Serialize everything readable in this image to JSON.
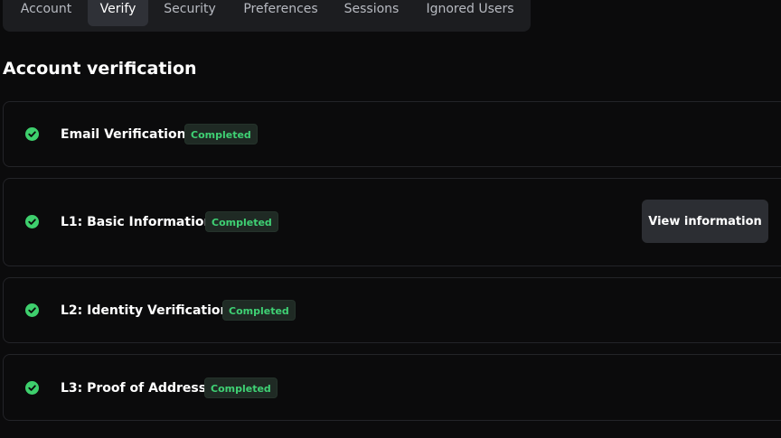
{
  "tabs": [
    {
      "label": "Account",
      "active": false
    },
    {
      "label": "Verify",
      "active": true
    },
    {
      "label": "Security",
      "active": false
    },
    {
      "label": "Preferences",
      "active": false
    },
    {
      "label": "Sessions",
      "active": false
    },
    {
      "label": "Ignored Users",
      "active": false
    }
  ],
  "page_title": "Account verification",
  "steps": [
    {
      "title": "Email Verification",
      "status": "Completed"
    },
    {
      "title": "L1: Basic Information",
      "status": "Completed",
      "action_label": "View information"
    },
    {
      "title": "L2: Identity Verification",
      "status": "Completed"
    },
    {
      "title": "L3: Proof of Address",
      "status": "Completed"
    }
  ],
  "colors": {
    "background": "#0b0b0c",
    "success_green": "#3ecf6d",
    "badge_bg": "#1f2a24",
    "tab_bar_bg": "#1c1d20",
    "active_tab_bg": "#2f3137",
    "button_bg": "#2c2e33"
  },
  "icons": {
    "step_status": "check-circle-icon"
  }
}
